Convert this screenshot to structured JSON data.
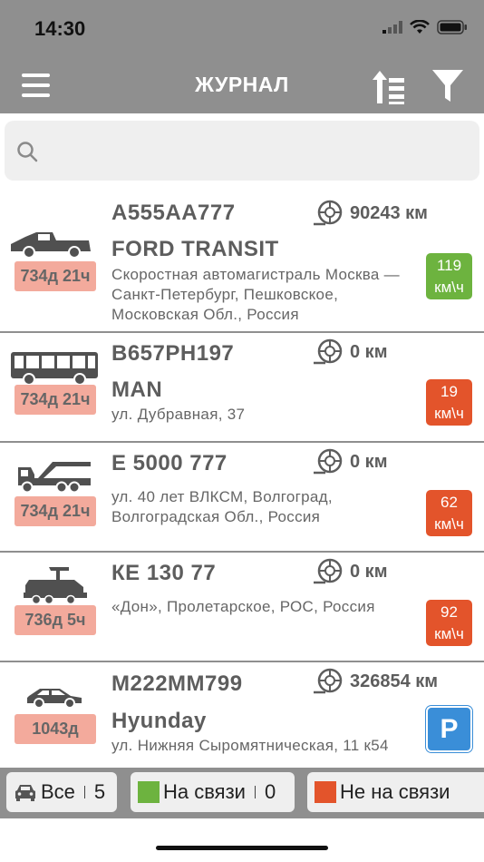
{
  "status": {
    "time": "14:30"
  },
  "nav": {
    "title": "ЖУРНАЛ"
  },
  "search": {
    "placeholder": "",
    "value": ""
  },
  "vehicles": [
    {
      "vehicle_icon": "pickup-truck-icon",
      "plate": "А555АА777",
      "odometer": "90243 км",
      "model": "FORD TRANSIT",
      "address": "Скоростная автомагистраль Москва — Санкт-Петербург, Пешковское, Московская Обл., Россия",
      "duration": "734д 21ч",
      "speed": "119 км\\ч",
      "status_color": "#6db33f"
    },
    {
      "vehicle_icon": "bus-icon",
      "plate": "В657РН197",
      "odometer": "0 км",
      "model": "MAN",
      "address": "ул. Дубравная, 37",
      "duration": "734д 21ч",
      "speed": "19 км\\ч",
      "status_color": "#e3542b"
    },
    {
      "vehicle_icon": "crane-truck-icon",
      "plate": "Е 5000 777",
      "odometer": "0 км",
      "model": "",
      "address": "ул. 40 лет ВЛКСМ, Волгоград, Волгоградская Обл., Россия",
      "duration": "734д 21ч",
      "speed": "62 км\\ч",
      "status_color": "#e3542b"
    },
    {
      "vehicle_icon": "paver-icon",
      "plate": "КЕ 130 77",
      "odometer": "0 км",
      "model": "",
      "address": "«Дон», Пролетарское, РОС, Россия",
      "duration": "736д 5ч",
      "speed": "92 км\\ч",
      "status_color": "#e3542b"
    },
    {
      "vehicle_icon": "sedan-icon",
      "plate": "М222ММ799",
      "odometer": "326854 км",
      "model": "Hyunday",
      "address": "ул. Нижняя Сыромятническая, 11 к54",
      "duration": "1043д",
      "speed": "P",
      "status_color": "#3a8ed8"
    }
  ],
  "filters": {
    "all": {
      "label": "Все",
      "count": "5"
    },
    "online": {
      "label": "На связи",
      "count": "0",
      "color": "#6db33f"
    },
    "offline": {
      "label": "Не на связи",
      "color": "#e3542b"
    }
  }
}
